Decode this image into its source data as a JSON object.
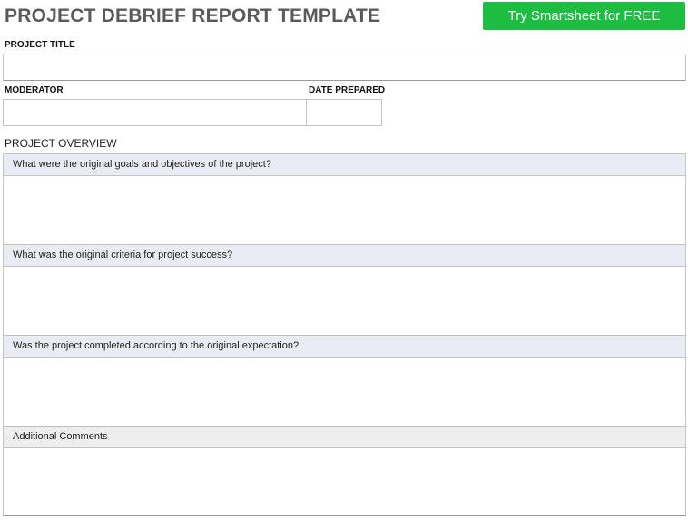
{
  "header": {
    "title": "PROJECT DEBRIEF REPORT TEMPLATE",
    "cta_label": "Try Smartsheet for FREE",
    "cta_color": "#1dbd42"
  },
  "fields": {
    "project_title_label": "PROJECT TITLE",
    "project_title_value": "",
    "moderator_label": "MODERATOR",
    "moderator_value": "",
    "date_prepared_label": "DATE PREPARED",
    "date_prepared_value": ""
  },
  "overview": {
    "section_title": "PROJECT OVERVIEW",
    "questions": [
      {
        "label": "What were the original goals and objectives of the project?",
        "answer": ""
      },
      {
        "label": "What was the original criteria for project success?",
        "answer": ""
      },
      {
        "label": "Was the project completed according to the original expectation?",
        "answer": ""
      },
      {
        "label": "Additional Comments",
        "answer": ""
      }
    ]
  },
  "colors": {
    "question_header_bg": "#e9edf3",
    "comments_header_bg": "#eeeeee",
    "border": "#c4c4c4"
  }
}
